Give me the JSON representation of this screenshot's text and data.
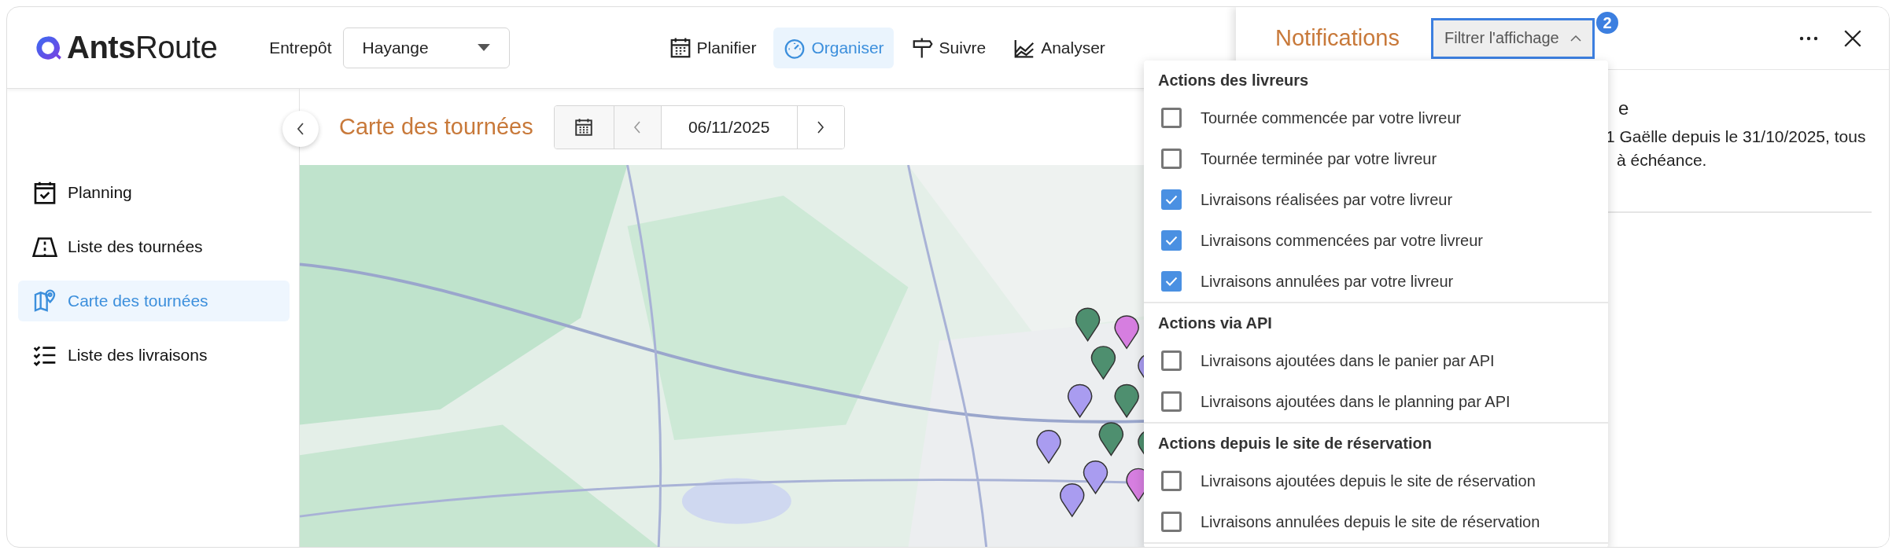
{
  "app": {
    "logo": "**Ants**Route"
  },
  "header": {
    "warehouse_label": "Entrepôt",
    "warehouse_select": {
      "value": "Hayange"
    },
    "nav": [
      {
        "label": "Planifier",
        "selected": false
      },
      {
        "label": "Organiser",
        "selected": true
      },
      {
        "label": "Suivre",
        "selected": false
      },
      {
        "label": "Analyser",
        "selected": false
      }
    ]
  },
  "sidebar": {
    "items": [
      {
        "label": "Planning",
        "selected": false
      },
      {
        "label": "Liste des tournées",
        "selected": false
      },
      {
        "label": "Carte des tournées",
        "selected": true
      },
      {
        "label": "Liste des livraisons",
        "selected": false
      }
    ]
  },
  "map_view": {
    "title": "Carte des tournées",
    "date": "06/11/2025"
  },
  "notifications": {
    "title": "Notifications",
    "filter_button": {
      "label": "Filtrer l'affichage",
      "badge": "2",
      "expanded": true
    },
    "notice_fragments": [
      "e",
      "1 Gaëlle depuis le 31/10/2025, tous",
      "à échéance."
    ],
    "filter_menu": {
      "sections": [
        {
          "heading": "Actions des livreurs",
          "options": [
            {
              "label": "Tournée commencée par votre livreur",
              "checked": false
            },
            {
              "label": "Tournée terminée par votre livreur",
              "checked": false
            },
            {
              "label": "Livraisons réalisées par votre livreur",
              "checked": true
            },
            {
              "label": "Livraisons commencées par votre livreur",
              "checked": true
            },
            {
              "label": "Livraisons annulées par votre livreur",
              "checked": true
            }
          ]
        },
        {
          "heading": "Actions via API",
          "options": [
            {
              "label": "Livraisons ajoutées dans le panier par API",
              "checked": false
            },
            {
              "label": "Livraisons ajoutées dans le planning par API",
              "checked": false
            }
          ]
        },
        {
          "heading": "Actions depuis le site de réservation",
          "options": [
            {
              "label": "Livraisons ajoutées depuis le site de réservation",
              "checked": false
            },
            {
              "label": "Livraisons annulées depuis le site de réservation",
              "checked": false
            }
          ]
        }
      ]
    }
  }
}
